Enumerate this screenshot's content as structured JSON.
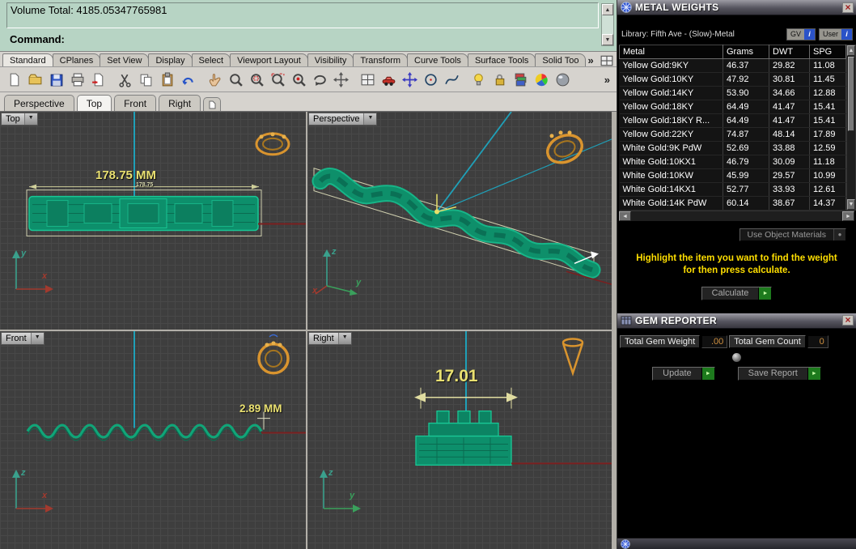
{
  "glyphs": {
    "up": "▲",
    "down": "▼",
    "left": "◄",
    "right": "►",
    "dropdown": "▼",
    "close": "×",
    "more": "»",
    "play": "►",
    "dot": "●",
    "info": "i"
  },
  "command_area": {
    "history_line": "Volume Total: 4185.05347765981",
    "prompt_label": "Command:"
  },
  "toolbar_tabs": {
    "items": [
      "Standard",
      "CPlanes",
      "Set View",
      "Display",
      "Select",
      "Viewport Layout",
      "Visibility",
      "Transform",
      "Curve Tools",
      "Surface Tools",
      "Solid Too"
    ],
    "active": "Standard"
  },
  "toolbar_icons": [
    "new-document",
    "open-file",
    "save",
    "print",
    "export-page",
    "cut",
    "copy",
    "paste",
    "undo",
    "pan-hand",
    "dynamic-zoom",
    "zoom-window",
    "zoom-extents",
    "zoom-selected",
    "rotate-view",
    "pan-view",
    "named-views",
    "render-car",
    "move-objects",
    "circle-tool",
    "curve-tool",
    "lightbulb",
    "lock",
    "layers",
    "color-wheel",
    "display-sphere"
  ],
  "viewport_tabs": {
    "items": [
      "Perspective",
      "Top",
      "Front",
      "Right"
    ],
    "active": "Top"
  },
  "viewports": {
    "top": {
      "label": "Top",
      "dimension": "178.75 MM",
      "dim_line_label": "178.75",
      "axis_v": "y",
      "axis_h": "x"
    },
    "perspective": {
      "label": "Perspective",
      "axis_z": "z",
      "axis_x": "x",
      "axis_y": "y"
    },
    "front": {
      "label": "Front",
      "dimension": "2.89 MM",
      "axis_v": "z",
      "axis_h": "x"
    },
    "right": {
      "label": "Right",
      "dimension": "17.01",
      "axis_v": "z",
      "axis_h": "y"
    }
  },
  "metal_weights": {
    "title": "METAL WEIGHTS",
    "library": "Library: Fifth Ave - (Slow)-Metal",
    "gv_button": "GV",
    "user_button": "User",
    "columns": [
      "Metal",
      "Grams",
      "DWT",
      "SPG"
    ],
    "rows": [
      [
        "Yellow Gold:9KY",
        "46.37",
        "29.82",
        "11.08"
      ],
      [
        "Yellow Gold:10KY",
        "47.92",
        "30.81",
        "11.45"
      ],
      [
        "Yellow Gold:14KY",
        "53.90",
        "34.66",
        "12.88"
      ],
      [
        "Yellow Gold:18KY",
        "64.49",
        "41.47",
        "15.41"
      ],
      [
        "Yellow Gold:18KY R...",
        "64.49",
        "41.47",
        "15.41"
      ],
      [
        "Yellow Gold:22KY",
        "74.87",
        "48.14",
        "17.89"
      ],
      [
        "White Gold:9K PdW",
        "52.69",
        "33.88",
        "12.59"
      ],
      [
        "White Gold:10KX1",
        "46.79",
        "30.09",
        "11.18"
      ],
      [
        "White Gold:10KW",
        "45.99",
        "29.57",
        "10.99"
      ],
      [
        "White Gold:14KX1",
        "52.77",
        "33.93",
        "12.61"
      ],
      [
        "White Gold:14K PdW",
        "60.14",
        "38.67",
        "14.37"
      ]
    ],
    "materials_button": "Use Object Materials",
    "instruction": "Highlight the item you want to find the weight for then press calculate.",
    "calculate_button": "Calculate"
  },
  "gem_reporter": {
    "title": "GEM REPORTER",
    "weight_label": "Total Gem Weight",
    "weight_value": ".00",
    "count_label": "Total Gem Count",
    "count_value": "0",
    "update_button": "Update",
    "save_button": "Save Report"
  },
  "colors": {
    "model_green": "#0e8f6b",
    "dimension_yellow": "#e9e070",
    "cplane_cyan": "#1fa0b8",
    "ring_orange": "#d9942e",
    "instruction_yellow": "#ffdf00",
    "go_green": "#1d7a1d"
  }
}
